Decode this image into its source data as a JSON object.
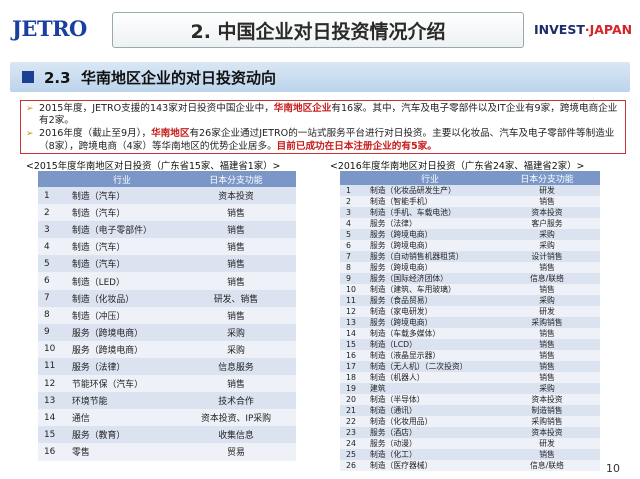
{
  "header": {
    "logo": "JETRO",
    "title": "2. 中国企业对日投资情况介绍",
    "invest_a": "INVEST",
    "invest_b": "JAPAN"
  },
  "section": {
    "number": "2.3",
    "title": "华南地区企业的对日投资动向"
  },
  "summary": {
    "p1_a": "2015年度，JETRO支援的143家对日投资中国企业中，",
    "p1_b": "华南地区企业",
    "p1_c": "有16家。其中，汽车及电子零部件以及IT企业有9家，跨境电商企业有2家。",
    "p2_a": "2016年度（截止至9月），",
    "p2_b": "华南地区",
    "p2_c": "有26家企业通过JETRO的一站式服务平台进行对日投资。主要以化妆品、汽车及电子零部件等制造业（8家），跨境电商（4家）等华南地区的优势企业居多。",
    "p2_d": "目前已成功在日本注册企业的有5家。"
  },
  "left_table": {
    "caption": "<2015年度华南地区对日投资（广东省15家、福建省1家）>",
    "headers": [
      "",
      "行业",
      "日本分支功能"
    ],
    "rows": [
      [
        "1",
        "制造（汽车）",
        "资本投资"
      ],
      [
        "2",
        "制造（汽车）",
        "销售"
      ],
      [
        "3",
        "制造（电子零部件）",
        "销售"
      ],
      [
        "4",
        "制造（汽车）",
        "销售"
      ],
      [
        "5",
        "制造（汽车）",
        "销售"
      ],
      [
        "6",
        "制造（LED）",
        "销售"
      ],
      [
        "7",
        "制造（化妆品）",
        "研发、销售"
      ],
      [
        "8",
        "制造（冲压）",
        "销售"
      ],
      [
        "9",
        "服务（跨境电商）",
        "采购"
      ],
      [
        "10",
        "服务（跨境电商）",
        "采购"
      ],
      [
        "11",
        "服务（法律）",
        "信息服务"
      ],
      [
        "12",
        "节能环保（汽车）",
        "销售"
      ],
      [
        "13",
        "环境节能",
        "技术合作"
      ],
      [
        "14",
        "通信",
        "资本投资、IP采购"
      ],
      [
        "15",
        "服务（教育）",
        "收集信息"
      ],
      [
        "16",
        "零售",
        "贸易"
      ]
    ]
  },
  "right_table": {
    "caption": "<2016年度华南地区对日投资（广东省24家、福建省2家）>",
    "headers": [
      "",
      "行业",
      "日本分支功能"
    ],
    "rows": [
      [
        "1",
        "制造（化妆品研发生产）",
        "研发"
      ],
      [
        "2",
        "制造（智能手机）",
        "销售"
      ],
      [
        "3",
        "制造（手机、车载电池）",
        "资本投资"
      ],
      [
        "4",
        "服务（法律）",
        "客户服务"
      ],
      [
        "5",
        "服务（跨境电商）",
        "采购"
      ],
      [
        "6",
        "服务（跨境电商）",
        "采购"
      ],
      [
        "7",
        "服务（自动销售机器租赁）",
        "设计销售"
      ],
      [
        "8",
        "服务（跨境电商）",
        "销售"
      ],
      [
        "9",
        "服务（国际经济团体）",
        "信息/联络"
      ],
      [
        "10",
        "制造（建筑、车用玻璃）",
        "销售"
      ],
      [
        "11",
        "服务（食品贸易）",
        "采购"
      ],
      [
        "12",
        "制造（家电研发）",
        "研发"
      ],
      [
        "13",
        "服务（跨境电商）",
        "采购销售"
      ],
      [
        "14",
        "制造（车载多媒体）",
        "销售"
      ],
      [
        "15",
        "制造（LCD）",
        "销售"
      ],
      [
        "16",
        "制造（液晶显示器）",
        "销售"
      ],
      [
        "17",
        "制造（无人机）（二次投资）",
        "销售"
      ],
      [
        "18",
        "制造（机器人）",
        "销售"
      ],
      [
        "19",
        "建筑",
        "采购"
      ],
      [
        "20",
        "制造（半导体）",
        "资本投资"
      ],
      [
        "21",
        "制造（通讯）",
        "制造销售"
      ],
      [
        "22",
        "制造（化妆用品）",
        "采购销售"
      ],
      [
        "23",
        "服务（酒店）",
        "资本投资"
      ],
      [
        "24",
        "服务（动漫）",
        "研发"
      ],
      [
        "25",
        "制造（化工）",
        "销售"
      ],
      [
        "26",
        "制造（医疗器械）",
        "信息/联络"
      ]
    ]
  },
  "page_number": "10"
}
